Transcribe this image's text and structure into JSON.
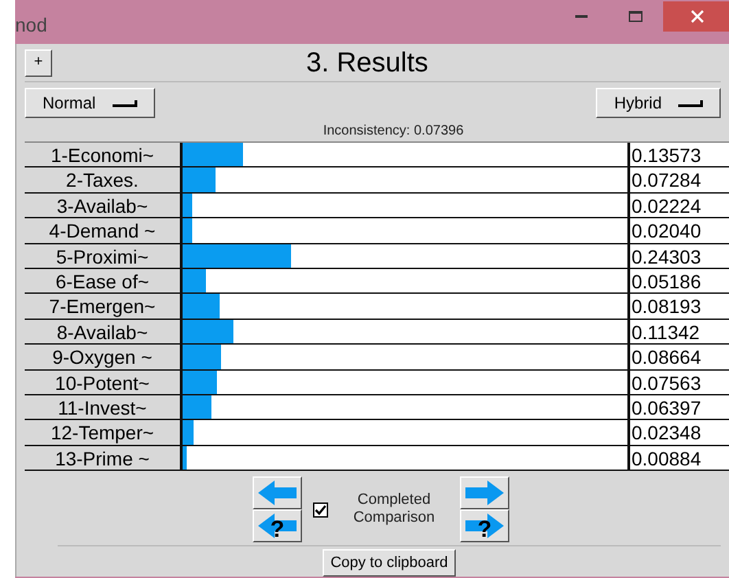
{
  "window": {
    "title": "nod"
  },
  "header": {
    "expand_button": "+",
    "title": "3. Results"
  },
  "left_dropdown": {
    "value": "Normal"
  },
  "right_dropdown": {
    "value": "Hybrid"
  },
  "inconsistency": "Inconsistency: 0.07396",
  "rows": [
    {
      "label": "1-Economi~",
      "level": 0.13573,
      "value": "0.13573"
    },
    {
      "label": "2-Taxes.",
      "level": 0.07284,
      "value": "0.07284"
    },
    {
      "label": "3-Availab~",
      "level": 0.02224,
      "value": "0.02224"
    },
    {
      "label": "4-Demand ~",
      "level": 0.0204,
      "value": "0.02040"
    },
    {
      "label": "5-Proximi~",
      "level": 0.24303,
      "value": "0.24303"
    },
    {
      "label": "6-Ease of~",
      "level": 0.05186,
      "value": "0.05186"
    },
    {
      "label": "7-Emergen~",
      "level": 0.08193,
      "value": "0.08193"
    },
    {
      "label": "8-Availab~",
      "level": 0.11342,
      "value": "0.11342"
    },
    {
      "label": "9-Oxygen ~",
      "level": 0.08664,
      "value": "0.08664"
    },
    {
      "label": "10-Potent~",
      "level": 0.07563,
      "value": "0.07563"
    },
    {
      "label": "11-Invest~",
      "level": 0.06397,
      "value": "0.06397"
    },
    {
      "label": "12-Temper~",
      "level": 0.02348,
      "value": "0.02348"
    },
    {
      "label": "13-Prime ~",
      "level": 0.00884,
      "value": "0.00884"
    }
  ],
  "nav": {
    "help_mark_left": "?",
    "help_mark_right": "?"
  },
  "completed": {
    "label": "Completed Comparison",
    "checked": true
  },
  "copy_button": "Copy to clipboard"
}
